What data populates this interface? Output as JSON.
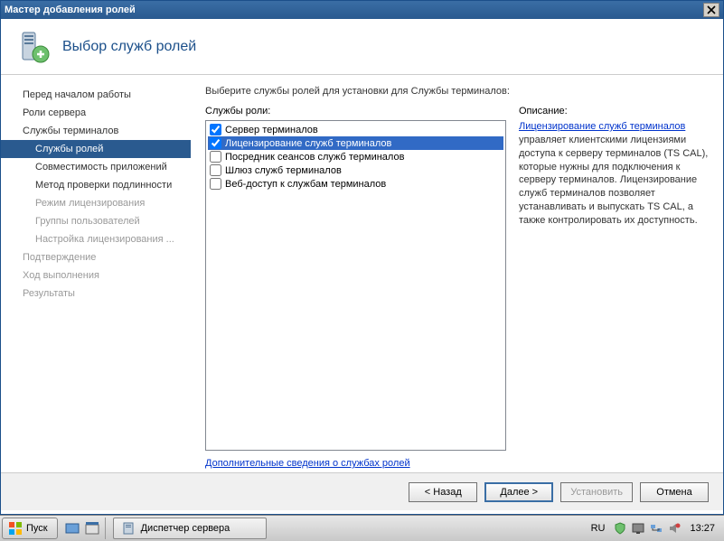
{
  "titlebar": {
    "title": "Мастер добавления ролей"
  },
  "header": {
    "title": "Выбор служб ролей"
  },
  "sidebar": {
    "items": [
      {
        "label": "Перед началом работы",
        "level": 1,
        "active": false,
        "disabled": false
      },
      {
        "label": "Роли сервера",
        "level": 1,
        "active": false,
        "disabled": false
      },
      {
        "label": "Службы терминалов",
        "level": 1,
        "active": false,
        "disabled": false
      },
      {
        "label": "Службы ролей",
        "level": 2,
        "active": true,
        "disabled": false
      },
      {
        "label": "Совместимость приложений",
        "level": 2,
        "active": false,
        "disabled": false
      },
      {
        "label": "Метод проверки подлинности",
        "level": 2,
        "active": false,
        "disabled": false
      },
      {
        "label": "Режим лицензирования",
        "level": 2,
        "active": false,
        "disabled": true
      },
      {
        "label": "Группы пользователей",
        "level": 2,
        "active": false,
        "disabled": true
      },
      {
        "label": "Настройка лицензирования ...",
        "level": 2,
        "active": false,
        "disabled": true
      },
      {
        "label": "Подтверждение",
        "level": 1,
        "active": false,
        "disabled": true
      },
      {
        "label": "Ход выполнения",
        "level": 1,
        "active": false,
        "disabled": true
      },
      {
        "label": "Результаты",
        "level": 1,
        "active": false,
        "disabled": true
      }
    ]
  },
  "main": {
    "instruction": "Выберите службы ролей для установки для Службы терминалов:",
    "roles_label": "Службы роли:",
    "roles": [
      {
        "label": "Сервер терминалов",
        "checked": true,
        "selected": false
      },
      {
        "label": "Лицензирование служб терминалов",
        "checked": true,
        "selected": true
      },
      {
        "label": "Посредник сеансов служб терминалов",
        "checked": false,
        "selected": false
      },
      {
        "label": "Шлюз служб терминалов",
        "checked": false,
        "selected": false
      },
      {
        "label": "Веб-доступ к службам терминалов",
        "checked": false,
        "selected": false
      }
    ],
    "desc_label": "Описание:",
    "desc_link": "Лицензирование служб терминалов",
    "desc_text": " управляет клиентскими лицензиями доступа к серверу терминалов (TS CAL), которые нужны для подключения к серверу терминалов. Лицензирование служб терминалов позволяет устанавливать и выпускать TS CAL, а также контролировать их доступность.",
    "more_link": "Дополнительные сведения о службах ролей"
  },
  "buttons": {
    "back": "< Назад",
    "next": "Далее >",
    "install": "Установить",
    "cancel": "Отмена"
  },
  "taskbar": {
    "start": "Пуск",
    "task": "Диспетчер сервера",
    "lang": "RU",
    "clock": "13:27"
  }
}
